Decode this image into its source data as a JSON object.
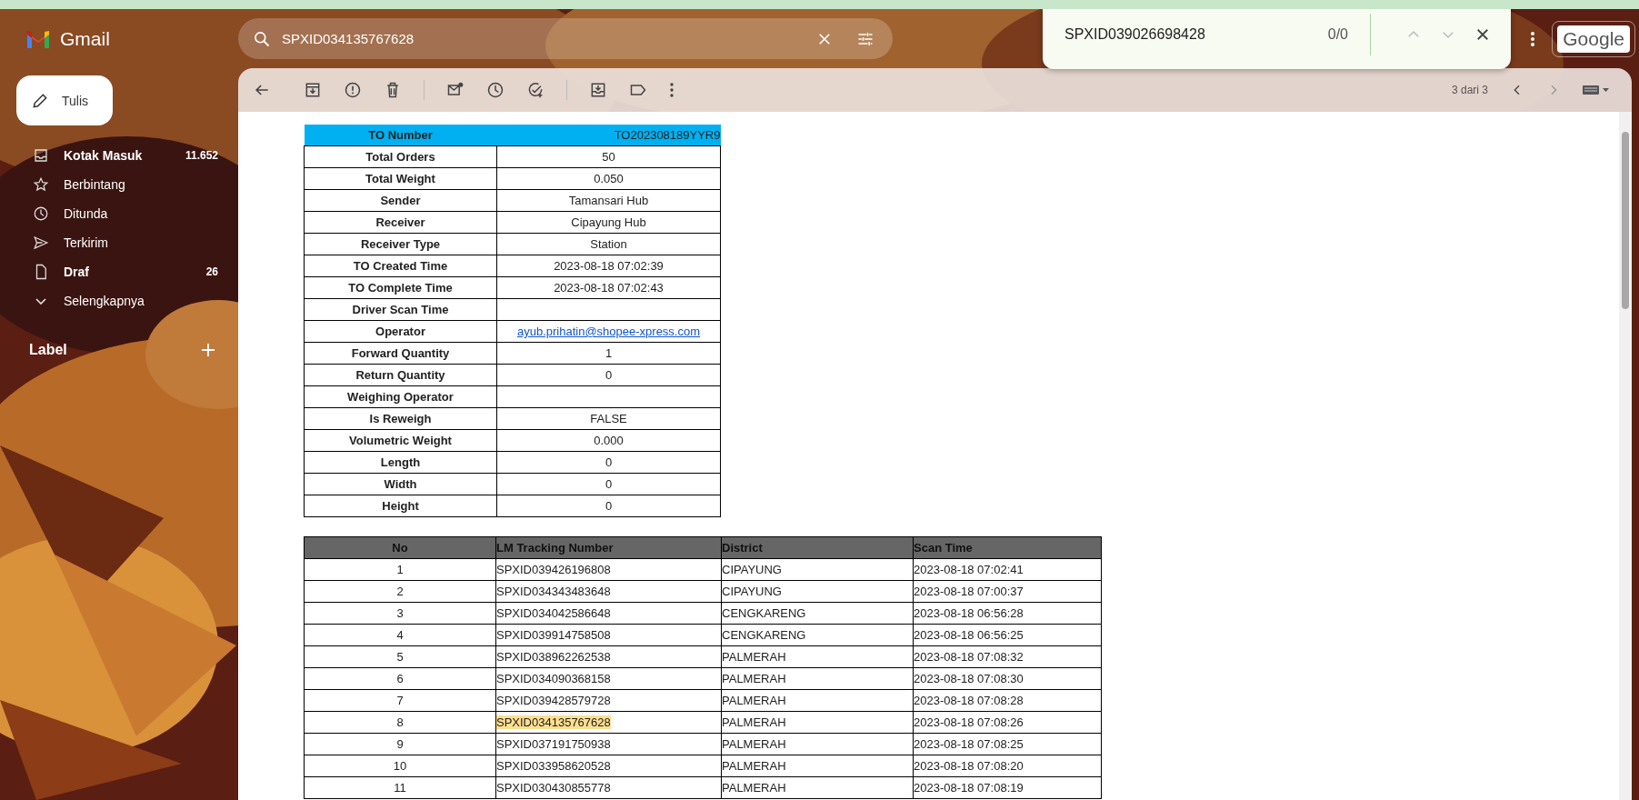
{
  "app": {
    "name": "Gmail"
  },
  "search": {
    "value": "SPXID034135767628"
  },
  "compose": {
    "label": "Tulis"
  },
  "nav": [
    {
      "kind": "inbox",
      "label": "Kotak Masuk",
      "count": "11.652",
      "unread": true
    },
    {
      "kind": "starred",
      "label": "Berbintang",
      "unread": false
    },
    {
      "kind": "snoozed",
      "label": "Ditunda",
      "unread": false
    },
    {
      "kind": "sent",
      "label": "Terkirim",
      "unread": false
    },
    {
      "kind": "drafts",
      "label": "Draf",
      "count": "26",
      "unread": true
    },
    {
      "kind": "more",
      "label": "Selengkapnya",
      "unread": false
    }
  ],
  "labels_section": {
    "title": "Label"
  },
  "find_bar": {
    "query": "SPXID039026698428",
    "count": "0/0"
  },
  "account": {
    "label": "Google"
  },
  "message": {
    "pager": "3 dari 3",
    "summary": {
      "header": {
        "label": "TO Number",
        "value": "TO202308189YYR9"
      },
      "rows": [
        {
          "label": "Total Orders",
          "value": "50",
          "kind": "text"
        },
        {
          "label": "Total Weight",
          "value": "0.050",
          "kind": "text"
        },
        {
          "label": "Sender",
          "value": "Tamansari Hub",
          "kind": "text"
        },
        {
          "label": "Receiver",
          "value": "Cipayung Hub",
          "kind": "text"
        },
        {
          "label": "Receiver Type",
          "value": "Station",
          "kind": "text"
        },
        {
          "label": "TO Created Time",
          "value": "2023-08-18 07:02:39",
          "kind": "text"
        },
        {
          "label": "TO Complete Time",
          "value": "2023-08-18 07:02:43",
          "kind": "text"
        },
        {
          "label": "Driver Scan Time",
          "kind": "text"
        },
        {
          "label": "Operator",
          "value": "ayub.prihatin@shopee-xpress.com",
          "kind": "link"
        },
        {
          "label": "Forward Quantity",
          "value": "1",
          "kind": "text"
        },
        {
          "label": "Return Quantity",
          "value": "0",
          "kind": "text"
        },
        {
          "label": "Weighing Operator",
          "kind": "text"
        },
        {
          "label": "Is Reweigh",
          "value": "FALSE",
          "kind": "text"
        },
        {
          "label": "Volumetric Weight",
          "value": "0.000",
          "kind": "text"
        },
        {
          "label": "Length",
          "value": "0",
          "kind": "text"
        },
        {
          "label": "Width",
          "value": "0",
          "kind": "text"
        },
        {
          "label": "Height",
          "value": "0",
          "kind": "text"
        }
      ]
    },
    "scans": {
      "columns": [
        "No",
        "LM Tracking Number",
        "District",
        "Scan Time"
      ],
      "rows": [
        {
          "no": "1",
          "tracking": "SPXID039426196808",
          "district": "CIPAYUNG",
          "time": "2023-08-18 07:02:41",
          "match": false
        },
        {
          "no": "2",
          "tracking": "SPXID034343483648",
          "district": "CIPAYUNG",
          "time": "2023-08-18 07:00:37",
          "match": false
        },
        {
          "no": "3",
          "tracking": "SPXID034042586648",
          "district": "CENGKARENG",
          "time": "2023-08-18 06:56:28",
          "match": false
        },
        {
          "no": "4",
          "tracking": "SPXID039914758508",
          "district": "CENGKARENG",
          "time": "2023-08-18 06:56:25",
          "match": false
        },
        {
          "no": "5",
          "tracking": "SPXID038962262538",
          "district": "PALMERAH",
          "time": "2023-08-18 07:08:32",
          "match": false
        },
        {
          "no": "6",
          "tracking": "SPXID034090368158",
          "district": "PALMERAH",
          "time": "2023-08-18 07:08:30",
          "match": false
        },
        {
          "no": "7",
          "tracking": "SPXID039428579728",
          "district": "PALMERAH",
          "time": "2023-08-18 07:08:28",
          "match": false
        },
        {
          "no": "8",
          "tracking": "SPXID034135767628",
          "district": "PALMERAH",
          "time": "2023-08-18 07:08:26",
          "match": true
        },
        {
          "no": "9",
          "tracking": "SPXID037191750938",
          "district": "PALMERAH",
          "time": "2023-08-18 07:08:25",
          "match": false
        },
        {
          "no": "10",
          "tracking": "SPXID033958620528",
          "district": "PALMERAH",
          "time": "2023-08-18 07:08:20",
          "match": false
        },
        {
          "no": "11",
          "tracking": "SPXID030430855778",
          "district": "PALMERAH",
          "time": "2023-08-18 07:08:19",
          "match": false
        }
      ]
    }
  }
}
